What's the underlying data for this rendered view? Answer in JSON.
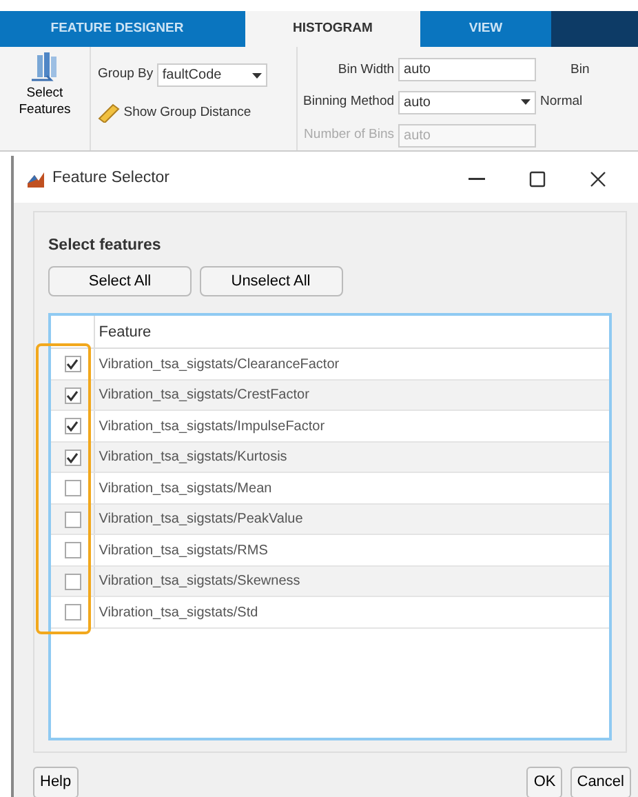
{
  "ribbon": {
    "tabs": [
      {
        "label": "FEATURE DESIGNER",
        "selected": false
      },
      {
        "label": "HISTOGRAM",
        "selected": true
      },
      {
        "label": "VIEW",
        "selected": false
      }
    ],
    "select_features": {
      "label": "Select Features"
    },
    "group_by": {
      "label": "Group By",
      "value": "faultCode"
    },
    "show_group_distance": {
      "label": "Show Group Distance"
    },
    "bin_width": {
      "label": "Bin Width",
      "value": "auto"
    },
    "binning_method": {
      "label": "Binning Method",
      "value": "auto"
    },
    "number_of_bins": {
      "label": "Number of Bins",
      "value": "auto",
      "disabled": true
    },
    "cut_labels": [
      "Bin",
      "Normal"
    ]
  },
  "dialog": {
    "title": "Feature Selector",
    "heading": "Select features",
    "buttons": [
      "Select All",
      "Unselect All"
    ],
    "table": {
      "columns": [
        "Feature"
      ],
      "rows": [
        {
          "feature": "Vibration_tsa_sigstats/ClearanceFactor",
          "checked": true
        },
        {
          "feature": "Vibration_tsa_sigstats/CrestFactor",
          "checked": true
        },
        {
          "feature": "Vibration_tsa_sigstats/ImpulseFactor",
          "checked": true
        },
        {
          "feature": "Vibration_tsa_sigstats/Kurtosis",
          "checked": true
        },
        {
          "feature": "Vibration_tsa_sigstats/Mean",
          "checked": false
        },
        {
          "feature": "Vibration_tsa_sigstats/PeakValue",
          "checked": false
        },
        {
          "feature": "Vibration_tsa_sigstats/RMS",
          "checked": false
        },
        {
          "feature": "Vibration_tsa_sigstats/Skewness",
          "checked": false
        },
        {
          "feature": "Vibration_tsa_sigstats/Std",
          "checked": false
        }
      ]
    },
    "footer_left": [
      "Help"
    ],
    "footer_right": [
      "OK",
      "Cancel"
    ]
  }
}
